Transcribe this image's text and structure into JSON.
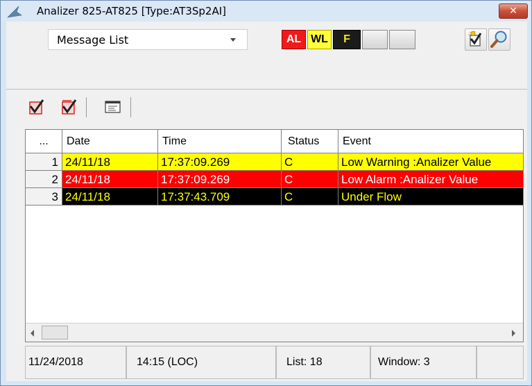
{
  "window": {
    "title": "Analizer 825-AT825  [Type:AT3Sp2AI]",
    "close_symbol": "✕"
  },
  "toolbar": {
    "view_select": {
      "selected": "Message List"
    },
    "flags": [
      {
        "label": "AL",
        "color": "#ef1b1b",
        "text_color": "#ffffff"
      },
      {
        "label": "WL",
        "color": "#ffff3c",
        "text_color": "#000000"
      },
      {
        "label": "F",
        "color": "#1b1b1b",
        "text_color": "#f4e81a"
      },
      {
        "label": "",
        "color": "#e2e2e2"
      },
      {
        "label": "",
        "color": "#e2e2e2"
      }
    ],
    "right_buttons": [
      {
        "icon": "acknowledge-icon"
      },
      {
        "icon": "magnifier-icon"
      }
    ]
  },
  "list_toolbar": {
    "buttons": [
      {
        "icon": "acknowledge-one-icon"
      },
      {
        "icon": "acknowledge-all-icon"
      },
      {
        "icon": "message-detail-icon"
      }
    ]
  },
  "grid": {
    "columns": [
      "...",
      "Date",
      "Time",
      "Status",
      "Event"
    ],
    "rows": [
      {
        "num": "1",
        "date": "24/11/18",
        "time": "17:37:09.269",
        "status": "C",
        "event": "Low Warning :Analizer Value",
        "bg": "#ffff00",
        "fg": "#000000"
      },
      {
        "num": "2",
        "date": "24/11/18",
        "time": "17:37:09.269",
        "status": "C",
        "event": "Low Alarm :Analizer Value",
        "bg": "#ff0000",
        "fg": "#ffffff"
      },
      {
        "num": "3",
        "date": "24/11/18",
        "time": "17:37:43.709",
        "status": "C",
        "event": "Under Flow",
        "bg": "#000000",
        "fg": "#ffff00"
      }
    ]
  },
  "statusbar": {
    "date": "11/24/2018",
    "time": "14:15 (LOC)",
    "list": "List: 18",
    "window": "Window: 3"
  }
}
